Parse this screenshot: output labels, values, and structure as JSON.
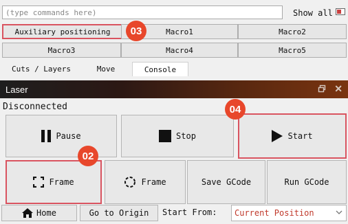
{
  "console": {
    "placeholder": "(type commands here)",
    "show_all_label": "Show all"
  },
  "macros": {
    "items": [
      "Auxiliary positioning",
      "Macro1",
      "Macro2",
      "Macro3",
      "Macro4",
      "Macro5"
    ]
  },
  "tabs": [
    "Cuts / Layers",
    "Move",
    "Console"
  ],
  "active_tab": "Console",
  "laser": {
    "title": "Laser",
    "status": "Disconnected",
    "pause_label": "Pause",
    "stop_label": "Stop",
    "start_label": "Start",
    "frame_label": "Frame",
    "frame_circle_label": "Frame",
    "save_gcode_label": "Save GCode",
    "run_gcode_label": "Run GCode",
    "home_label": "Home",
    "go_to_origin_label": "Go to Origin",
    "start_from_label": "Start From:",
    "start_from_value": "Current Position"
  },
  "annotations": {
    "badge_02": "02",
    "badge_03": "03",
    "badge_04": "04",
    "color": "#e8472b"
  },
  "colors": {
    "highlight_border": "#d9535f",
    "select_text": "#c0392b"
  },
  "icons": [
    "pause-icon",
    "stop-icon",
    "play-icon",
    "frame-square-icon",
    "frame-circle-icon",
    "home-icon",
    "float-window-icon",
    "close-icon",
    "chevron-down-icon"
  ]
}
